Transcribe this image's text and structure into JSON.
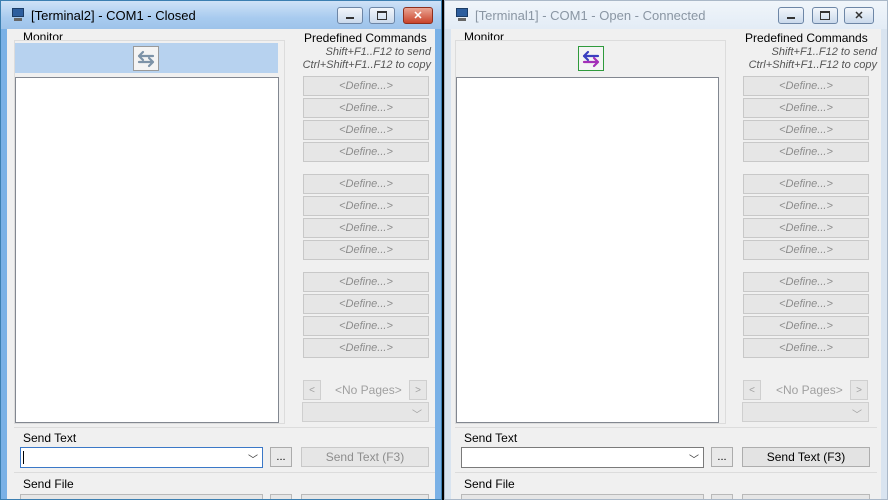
{
  "windows": [
    {
      "title": "[Terminal2] - COM1 - Closed",
      "state": "active",
      "monitor_label": "Monitor",
      "connect_icon": "swap-arrows-icon-gray",
      "predefined_title": "Predefined Commands",
      "hint_send": "Shift+F1..F12 to send",
      "hint_copy": "Ctrl+Shift+F1..F12 to copy",
      "define_label": "<Define...>",
      "no_pages": "<No Pages>",
      "send_text_label": "Send Text",
      "browse_label": "...",
      "send_text_button": "Send Text (F3)",
      "send_file_label": "Send File"
    },
    {
      "title": "[Terminal1] - COM1 - Open - Connected",
      "state": "inactive",
      "monitor_label": "Monitor",
      "connect_icon": "swap-arrows-icon-purple",
      "predefined_title": "Predefined Commands",
      "hint_send": "Shift+F1..F12 to send",
      "hint_copy": "Ctrl+Shift+F1..F12 to copy",
      "define_label": "<Define...>",
      "no_pages": "<No Pages>",
      "send_text_label": "Send Text",
      "browse_label": "...",
      "send_text_button": "Send Text (F3)",
      "send_file_label": "Send File"
    }
  ],
  "colors": {
    "active_title": "#a8cbef",
    "inactive_title": "#e3ecf6",
    "arrow_gray": "#7d93a8",
    "arrow_purple": "#6a35b8",
    "close_red": "#c9432a"
  }
}
